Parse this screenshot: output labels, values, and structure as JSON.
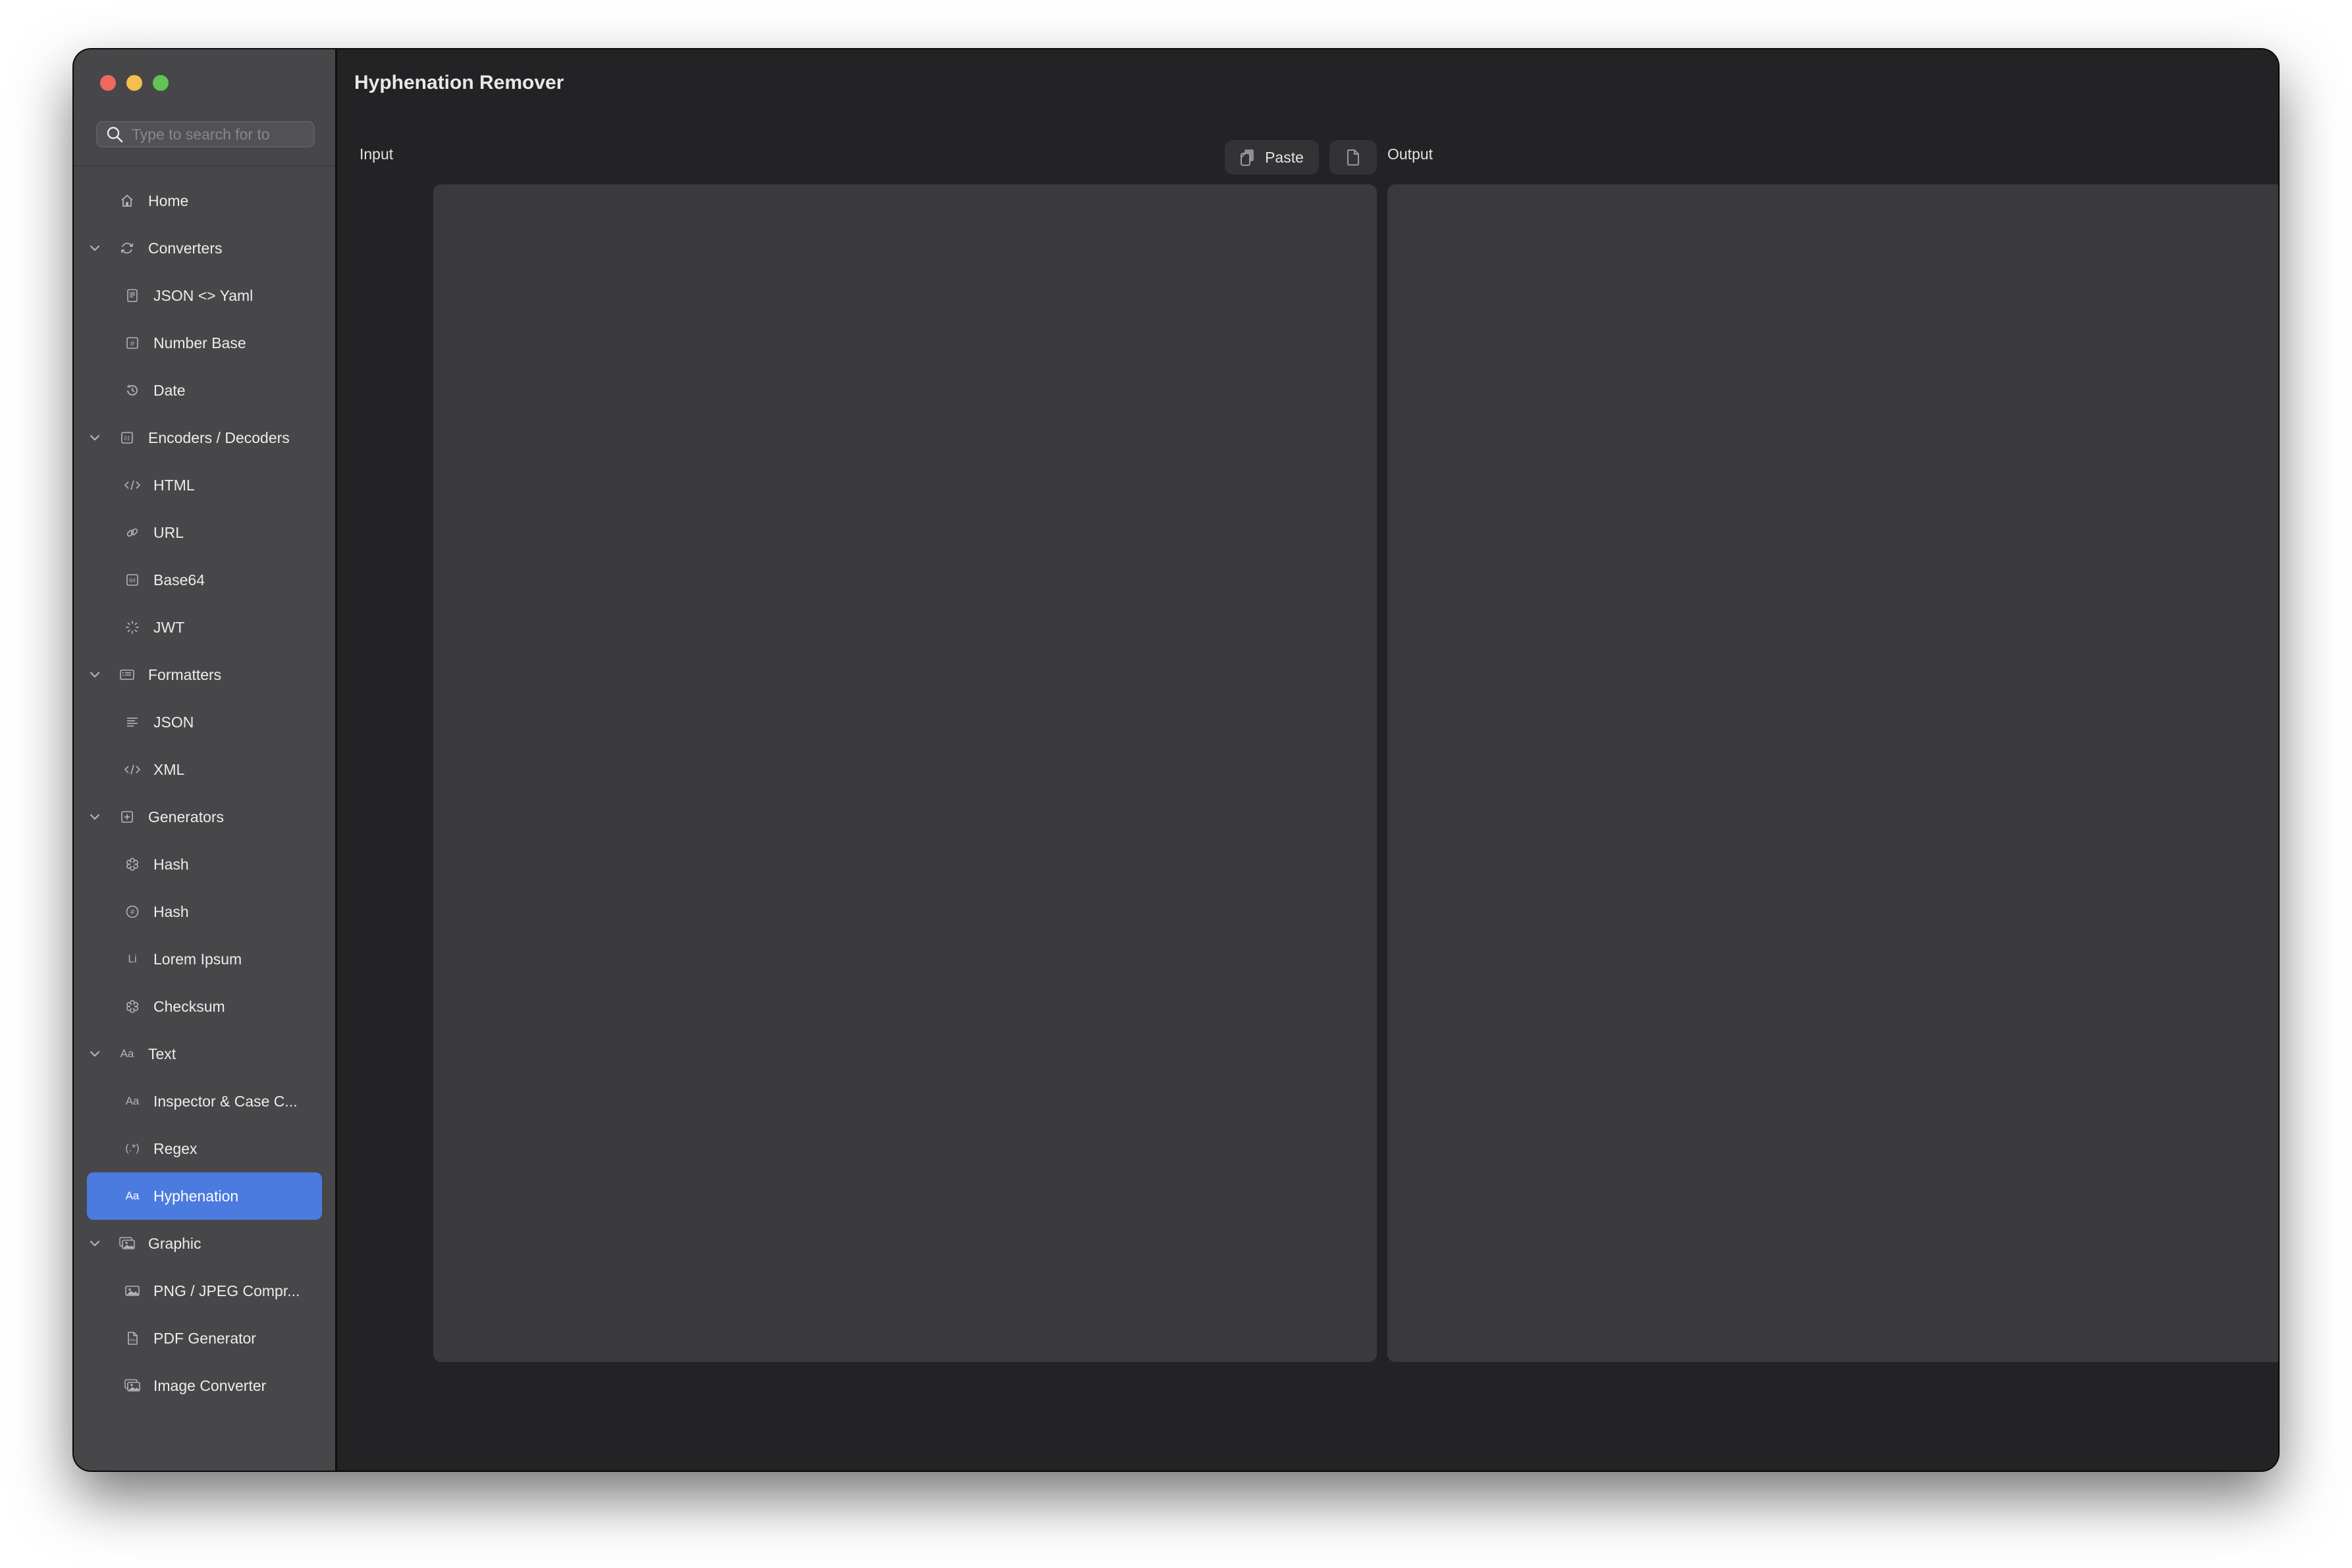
{
  "window": {
    "controls": [
      {
        "name": "close",
        "color": "#ec6a5e"
      },
      {
        "name": "minimize",
        "color": "#f4bf4f"
      },
      {
        "name": "zoom",
        "color": "#61c554"
      }
    ]
  },
  "sidebar": {
    "search": {
      "placeholder": "Type to search for to",
      "value": ""
    },
    "items": [
      {
        "type": "item",
        "label": "Home",
        "icon": "house-icon"
      },
      {
        "type": "group",
        "label": "Converters",
        "icon": "arrows-circle-icon",
        "expanded": true,
        "children": [
          {
            "label": "JSON <> Yaml",
            "icon": "document-text-icon"
          },
          {
            "label": "Number Base",
            "icon": "number-square-icon"
          },
          {
            "label": "Date",
            "icon": "clock-history-icon"
          }
        ]
      },
      {
        "type": "group",
        "label": "Encoders / Decoders",
        "icon": "binary-square-icon",
        "expanded": true,
        "children": [
          {
            "label": "HTML",
            "icon": "code-brackets-icon"
          },
          {
            "label": "URL",
            "icon": "link-icon"
          },
          {
            "label": "Base64",
            "icon": "base64-square-icon"
          },
          {
            "label": "JWT",
            "icon": "sparkle-spinner-icon"
          }
        ]
      },
      {
        "type": "group",
        "label": "Formatters",
        "icon": "list-rectangle-icon",
        "expanded": true,
        "children": [
          {
            "label": "JSON",
            "icon": "text-align-left-icon"
          },
          {
            "label": "XML",
            "icon": "code-brackets-icon"
          }
        ]
      },
      {
        "type": "group",
        "label": "Generators",
        "icon": "plus-square-icon",
        "expanded": true,
        "children": [
          {
            "label": "Hash",
            "icon": "asterisk-icon"
          },
          {
            "label": "Hash",
            "icon": "number-circle-icon"
          },
          {
            "label": "Lorem Ipsum",
            "icon": "li-text-icon"
          },
          {
            "label": "Checksum",
            "icon": "asterisk-icon"
          }
        ]
      },
      {
        "type": "group",
        "label": "Text",
        "icon": "textformat-icon",
        "expanded": true,
        "children": [
          {
            "label": "Inspector & Case C...",
            "icon": "textformat-icon"
          },
          {
            "label": "Regex",
            "icon": "regex-icon"
          },
          {
            "label": "Hyphenation",
            "icon": "textformat-icon",
            "selected": true
          }
        ]
      },
      {
        "type": "group",
        "label": "Graphic",
        "icon": "photo-stack-icon",
        "expanded": true,
        "children": [
          {
            "label": "PNG / JPEG Compr...",
            "icon": "photo-icon"
          },
          {
            "label": "PDF Generator",
            "icon": "pdf-document-icon"
          },
          {
            "label": "Image Converter",
            "icon": "photo-stack-icon"
          }
        ]
      }
    ],
    "selected_color": "#4c7be0"
  },
  "main": {
    "title": "Hyphenation Remover",
    "input": {
      "label": "Input",
      "paste_label": "Paste",
      "value": ""
    },
    "output": {
      "label": "Output",
      "value": ""
    }
  }
}
